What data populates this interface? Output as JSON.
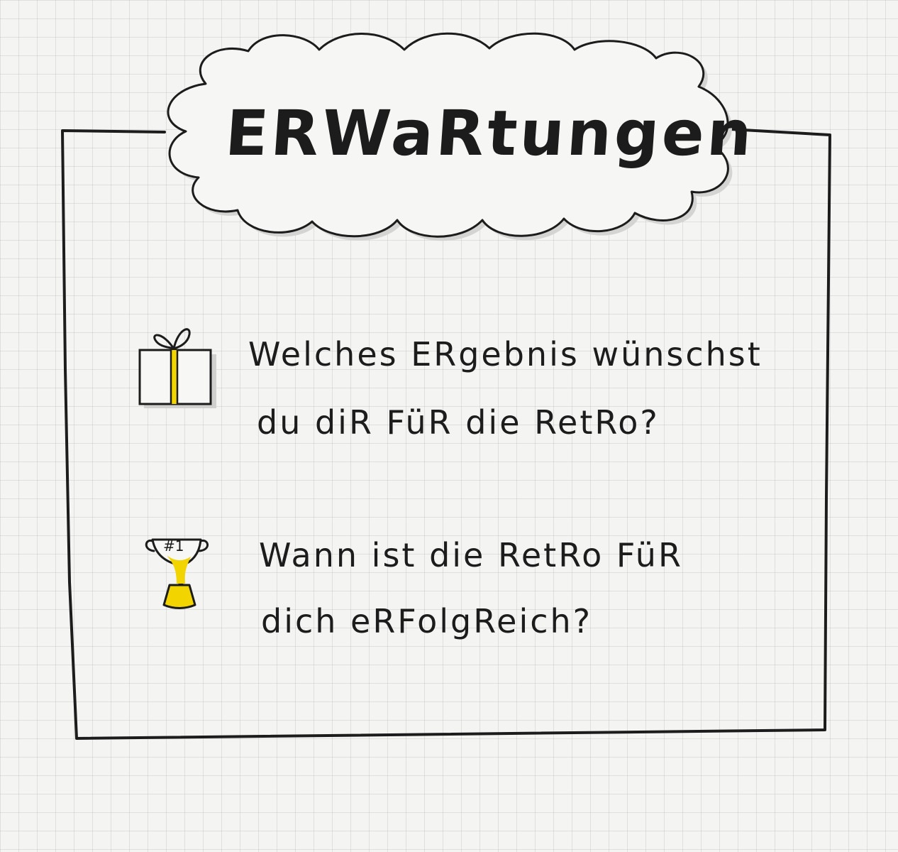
{
  "title": "ERWaRtungen",
  "questions": [
    {
      "icon": "gift-icon",
      "line1": "Welches ERgebnis wünschst",
      "line2": "du diR FüR die RetRo?"
    },
    {
      "icon": "trophy-icon",
      "trophy_label": "#1",
      "line1": "Wann ist die RetRo FüR",
      "line2": "dich eRFolgReich?"
    }
  ],
  "colors": {
    "ink": "#1c1c1c",
    "paper": "#f4f4f2",
    "grid": "#c8c8c8",
    "highlight": "#f2d400",
    "shadow": "#cfcfcf"
  }
}
